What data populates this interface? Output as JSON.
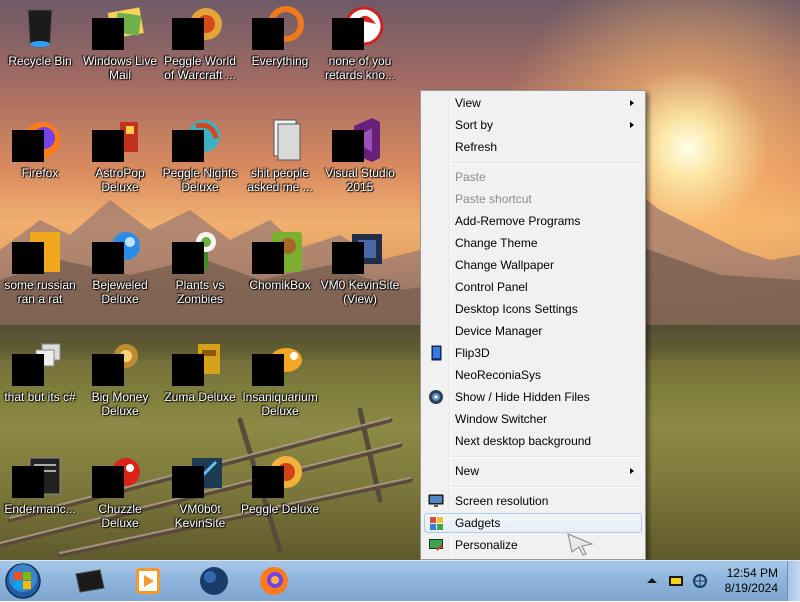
{
  "desktop_icons": [
    {
      "label": "Recycle Bin",
      "icon": "recycle-bin-icon"
    },
    {
      "label": "Windows Live Mail",
      "icon": "windows-live-mail-icon"
    },
    {
      "label": "Peggle World of Warcraft ...",
      "icon": "peggle-world-of-warcraft-icon"
    },
    {
      "label": "Everything",
      "icon": "everything-search-icon"
    },
    {
      "label": "none of you retards kno...",
      "icon": "app-icon"
    },
    {
      "label": "Firefox",
      "icon": "firefox-icon"
    },
    {
      "label": "AstroPop Deluxe",
      "icon": "astropop-deluxe-icon"
    },
    {
      "label": "Peggle Nights Deluxe",
      "icon": "peggle-nights-deluxe-icon"
    },
    {
      "label": "shit people asked me ...",
      "icon": "folder-icon"
    },
    {
      "label": "Visual Studio 2015",
      "icon": "visual-studio-icon"
    },
    {
      "label": "some russian ran a rat",
      "icon": "app-icon"
    },
    {
      "label": "Bejeweled Deluxe",
      "icon": "bejeweled-deluxe-icon"
    },
    {
      "label": "Plants vs Zombies",
      "icon": "plants-vs-zombies-icon"
    },
    {
      "label": "ChomikBox",
      "icon": "chomikbox-icon"
    },
    {
      "label": "VM0 KevinSite (View)",
      "icon": "vm-kevinsite-view-icon"
    },
    {
      "label": "that but its c#",
      "icon": "stacked-windows-icon"
    },
    {
      "label": "Big Money Deluxe",
      "icon": "big-money-deluxe-icon"
    },
    {
      "label": "Zuma Deluxe",
      "icon": "zuma-deluxe-icon"
    },
    {
      "label": "Insaniquarium Deluxe",
      "icon": "insaniquarium-deluxe-icon"
    },
    {
      "label": "Endermanc...",
      "icon": "endermanch-icon"
    },
    {
      "label": "Chuzzle Deluxe",
      "icon": "chuzzle-deluxe-icon"
    },
    {
      "label": "VM0b0t KevinSite",
      "icon": "vm-kevinsite-icon"
    },
    {
      "label": "Peggle Deluxe",
      "icon": "peggle-deluxe-icon"
    }
  ],
  "context_menu": {
    "view": "View",
    "sort_by": "Sort by",
    "refresh": "Refresh",
    "paste": "Paste",
    "paste_shortcut": "Paste shortcut",
    "add_remove_programs": "Add-Remove Programs",
    "change_theme": "Change Theme",
    "change_wallpaper": "Change Wallpaper",
    "control_panel": "Control Panel",
    "desktop_icons_settings": "Desktop Icons Settings",
    "device_manager": "Device Manager",
    "flip3d": "Flip3D",
    "neoreconiasys": "NeoReconiaSys",
    "show_hide_hidden_files": "Show / Hide Hidden Files",
    "window_switcher": "Window Switcher",
    "next_desktop_background": "Next desktop background",
    "new": "New",
    "screen_resolution": "Screen resolution",
    "gadgets": "Gadgets",
    "personalize": "Personalize"
  },
  "taskbar": {
    "pinned": [
      "terminal-icon",
      "media-player-icon",
      "globe-icon",
      "firefox-icon"
    ],
    "clock_time": "12:54 PM",
    "clock_date": "8/19/2024"
  },
  "colors": {
    "menu_bg": "#f1f1f1",
    "menu_hover": "#e4edf8",
    "taskbar": "#8fb5dc",
    "disabled_text": "#8d8d8d"
  }
}
